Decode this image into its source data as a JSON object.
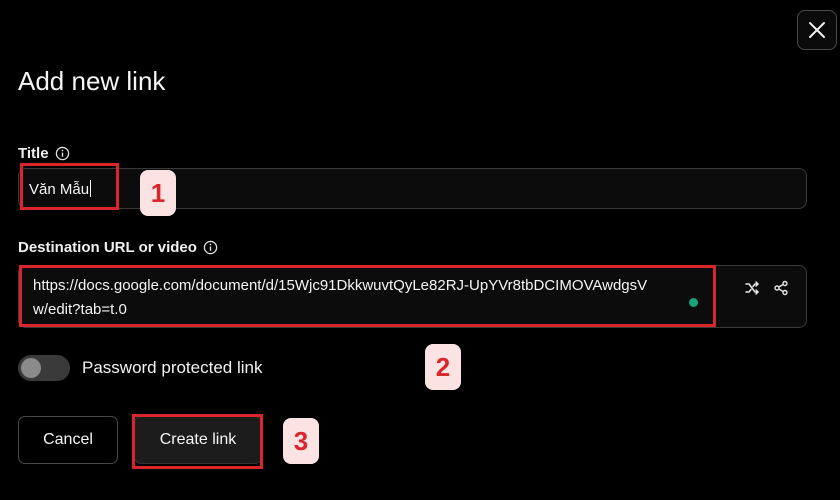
{
  "dialog": {
    "heading": "Add new link",
    "close_icon": "close-icon"
  },
  "title_field": {
    "label": "Title",
    "value": "Văn Mẫu",
    "info_icon": "info-icon"
  },
  "url_field": {
    "label": "Destination URL or video",
    "value_line1": "https://docs.google.com/document/d/15Wjc91DkkwuvtQyLe82RJ-UpYVr8tbDCIMOVAwdgsV",
    "value_line2": "w/edit?tab=t.0",
    "info_icon": "info-icon",
    "actions": [
      "shuffle-icon",
      "share-icon"
    ]
  },
  "password_toggle": {
    "label": "Password protected link",
    "enabled": false
  },
  "buttons": {
    "cancel": "Cancel",
    "create": "Create link"
  },
  "annotations": {
    "step1": "1",
    "step2": "2",
    "step3": "3",
    "highlight_color": "#d9262b",
    "badge_color": "#fbe3e4"
  },
  "colors": {
    "background": "#000000",
    "status_dot": "#1aa37a"
  }
}
